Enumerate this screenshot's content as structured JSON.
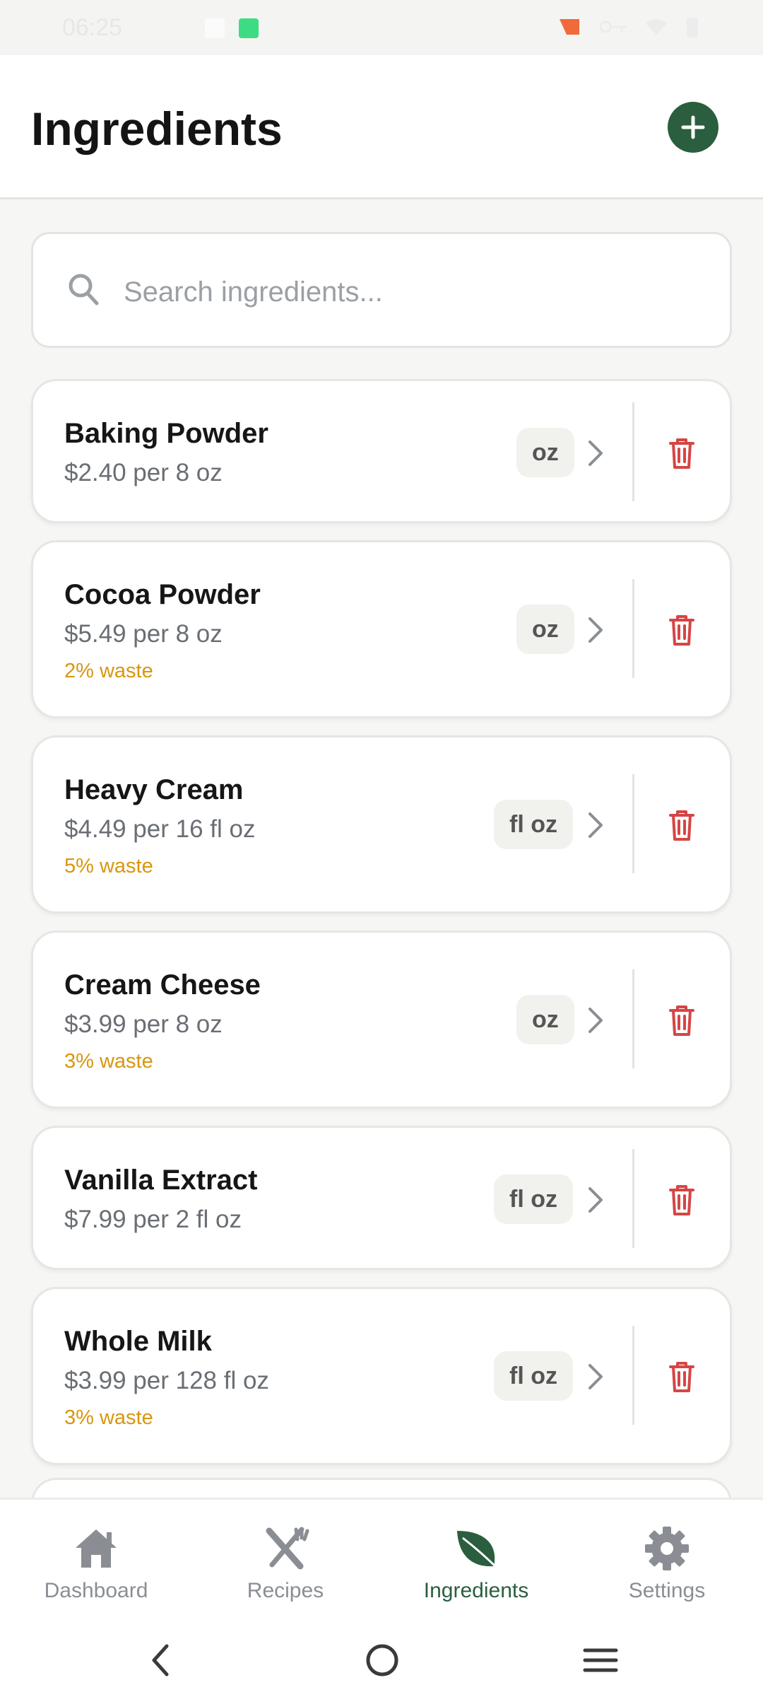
{
  "status_bar": {
    "time": "06:25"
  },
  "header": {
    "title": "Ingredients"
  },
  "search": {
    "placeholder": "Search ingredients..."
  },
  "ingredients": [
    {
      "name": "Baking Powder",
      "price": "$2.40 per 8 oz",
      "waste": "",
      "unit": "oz"
    },
    {
      "name": "Cocoa Powder",
      "price": "$5.49 per 8 oz",
      "waste": "2% waste",
      "unit": "oz"
    },
    {
      "name": "Heavy Cream",
      "price": "$4.49 per 16 fl oz",
      "waste": "5% waste",
      "unit": "fl oz"
    },
    {
      "name": "Cream Cheese",
      "price": "$3.99 per 8 oz",
      "waste": "3% waste",
      "unit": "oz"
    },
    {
      "name": "Vanilla Extract",
      "price": "$7.99 per 2 fl oz",
      "waste": "",
      "unit": "fl oz"
    },
    {
      "name": "Whole Milk",
      "price": "$3.99 per 128 fl oz",
      "waste": "3% waste",
      "unit": "fl oz"
    }
  ],
  "bottom_nav": {
    "items": [
      {
        "label": "Dashboard",
        "icon": "home-icon"
      },
      {
        "label": "Recipes",
        "icon": "utensils-icon"
      },
      {
        "label": "Ingredients",
        "icon": "leaf-icon",
        "active": true
      },
      {
        "label": "Settings",
        "icon": "gear-icon"
      }
    ]
  },
  "colors": {
    "accent": "#2a5e3e",
    "waste": "#d8960e",
    "delete": "#d64545",
    "inactive_nav": "#8a8e94"
  }
}
